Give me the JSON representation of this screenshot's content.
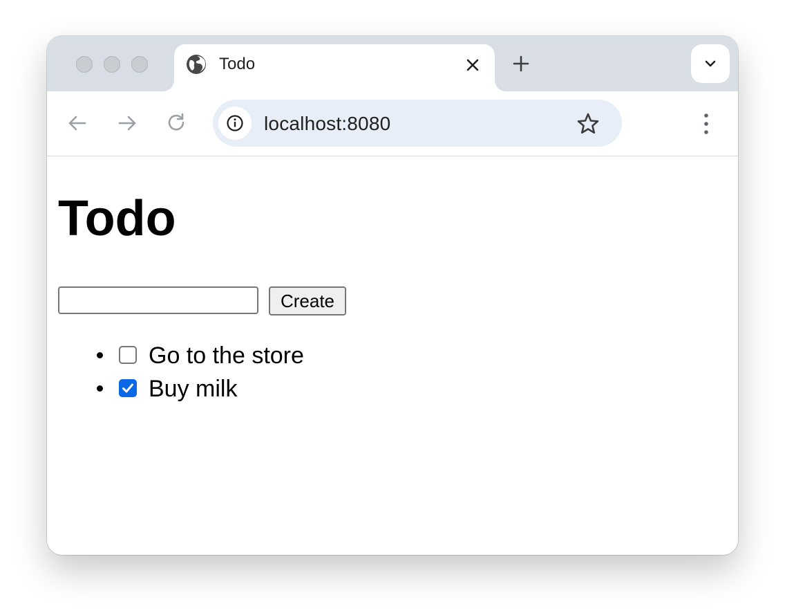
{
  "browser": {
    "tab": {
      "title": "Todo",
      "favicon": "globe-icon",
      "close_icon": "close-icon"
    },
    "new_tab_icon": "plus-icon",
    "tab_search_icon": "chevron-down-icon",
    "toolbar": {
      "back_icon": "arrow-left-icon",
      "forward_icon": "arrow-right-icon",
      "reload_icon": "reload-icon",
      "site_info_icon": "info-icon",
      "url": "localhost:8080",
      "bookmark_icon": "star-icon",
      "menu_icon": "kebab-menu-icon"
    }
  },
  "page": {
    "title": "Todo",
    "input": {
      "value": "",
      "placeholder": ""
    },
    "create_label": "Create",
    "todos": [
      {
        "text": "Go to the store",
        "done": false
      },
      {
        "text": "Buy milk",
        "done": true
      }
    ]
  },
  "colors": {
    "tabstrip": "#d9dee6",
    "omnibox": "#e8eef8",
    "checkbox_accent": "#0b67e6"
  }
}
